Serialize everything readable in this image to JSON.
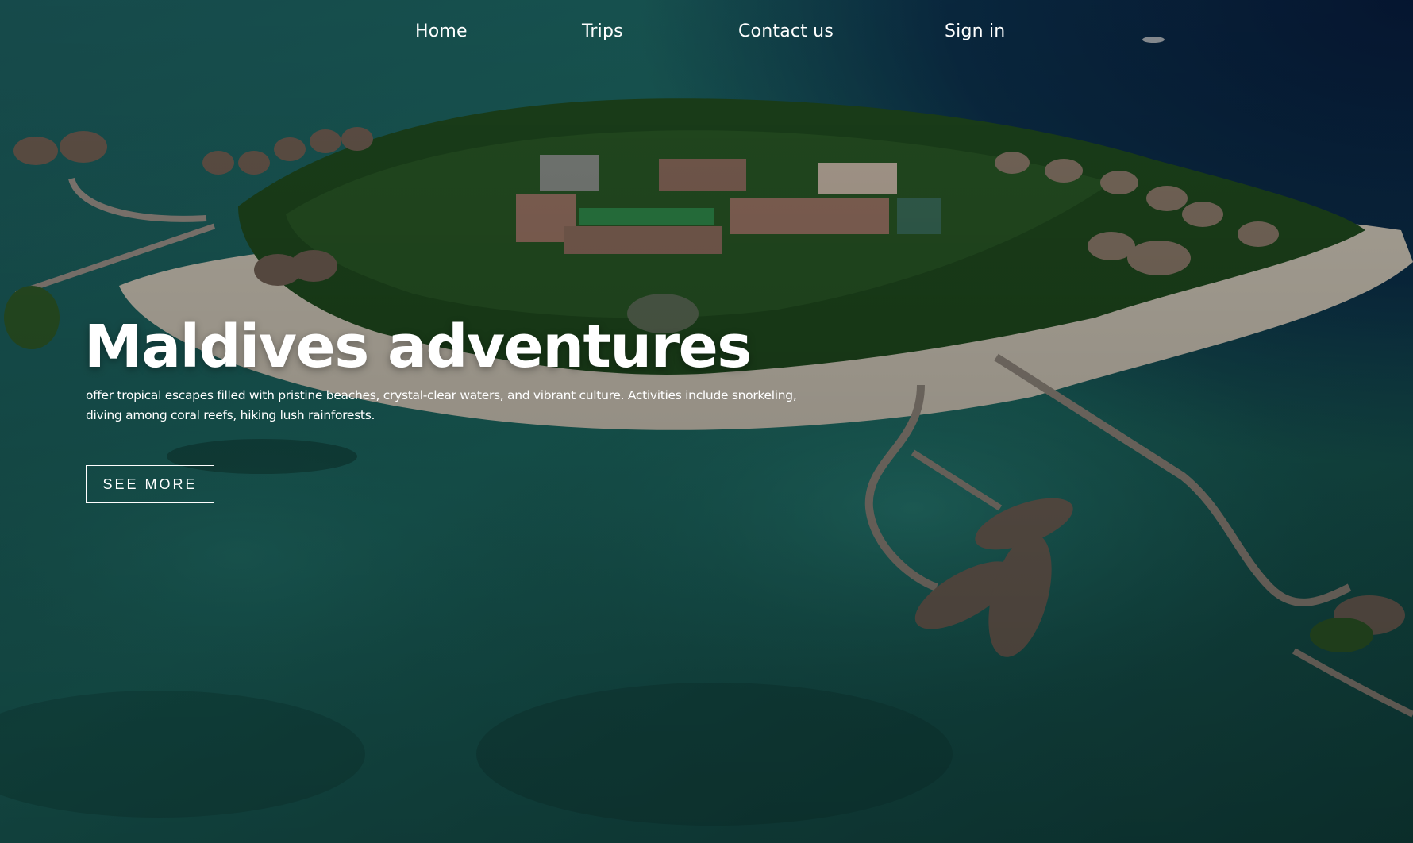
{
  "nav": {
    "items": [
      {
        "label": "Home"
      },
      {
        "label": "Trips"
      },
      {
        "label": "Contact us"
      },
      {
        "label": "Sign in"
      }
    ]
  },
  "hero": {
    "title": "Maldives adventures",
    "description": "offer tropical escapes filled with pristine beaches, crystal-clear waters, and vibrant culture. Activities include snorkeling, diving among coral reefs, hiking lush rainforests.",
    "cta_label": "SEE MORE",
    "background_image": "aerial-island-resort-photo"
  },
  "colors": {
    "text": "#ffffff",
    "ocean": "#1d6a64",
    "deep_ocean": "#0a1f3d",
    "sand": "#cfc7b8",
    "foliage": "#1f4a1e"
  }
}
